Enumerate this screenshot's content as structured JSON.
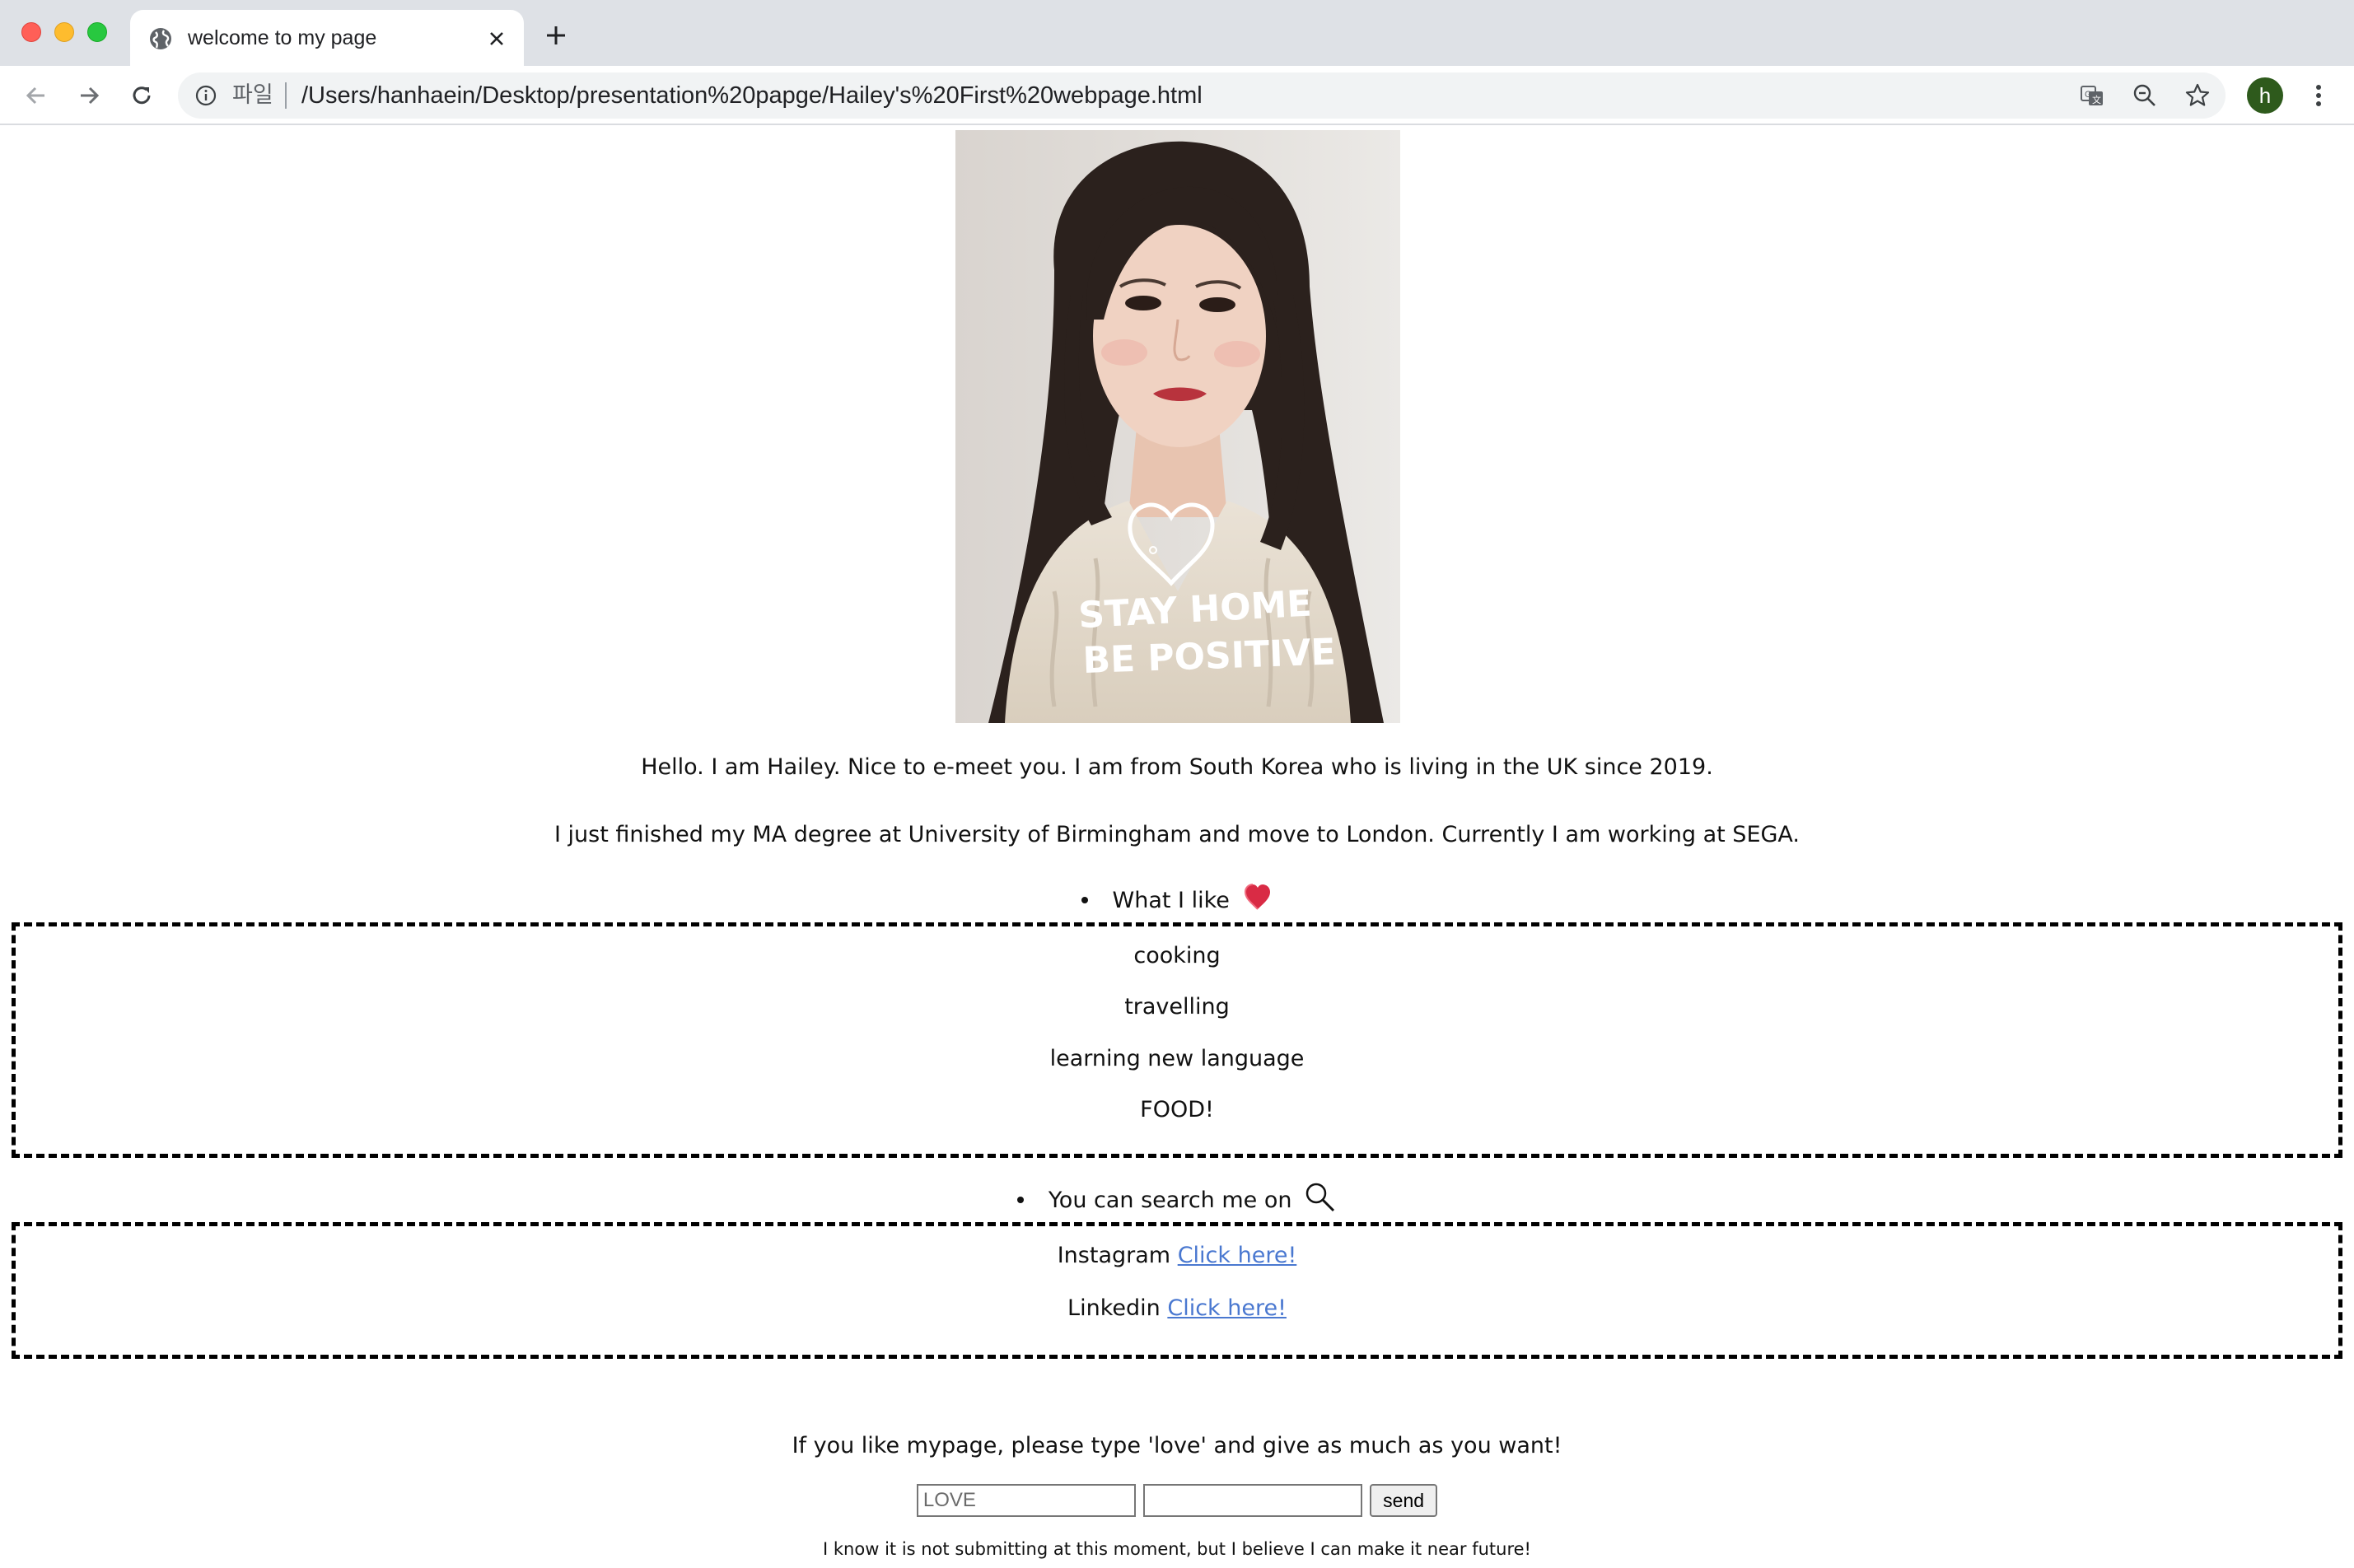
{
  "browser": {
    "tab_title": "welcome to my page",
    "scheme_label": "파일",
    "url": "/Users/hanhaein/Desktop/presentation%20papge/Hailey's%20First%20webpage.html",
    "profile_initial": "h",
    "profile_color": "#2e5a1c",
    "icons": [
      "globe-icon",
      "close-icon",
      "plus-icon",
      "back-icon",
      "forward-icon",
      "reload-icon",
      "info-icon",
      "translate-icon",
      "zoom-out-icon",
      "star-icon",
      "menu-icon"
    ]
  },
  "page": {
    "photo_text": [
      "STAY HOME",
      "BE POSITIVE"
    ],
    "intro_1": "Hello. I am Hailey. Nice to e-meet you. I am from South Korea who is living in the UK since 2019.",
    "intro_2": "I just finished my MA degree at University of Birmingham and move to London. Currently I am working at SEGA.",
    "likes": {
      "heading": "What I like",
      "heading_icon": "heart-icon",
      "items": [
        "cooking",
        "travelling",
        "learning new language",
        "FOOD!"
      ]
    },
    "search": {
      "heading": "You can search me on",
      "heading_icon": "magnifier-icon",
      "links": [
        {
          "label": "Instagram",
          "link_text": "Click here!"
        },
        {
          "label": "Linkedin",
          "link_text": "Click here!"
        }
      ]
    },
    "love_prompt": "If you like mypage, please type 'love' and give as much as you want!",
    "form": {
      "input1_placeholder": "LOVE",
      "input2_value": "",
      "send_label": "send"
    },
    "footnote": "I know it is not submitting at this moment, but I believe I can make it near future!",
    "link_color": "#4a78d0"
  }
}
